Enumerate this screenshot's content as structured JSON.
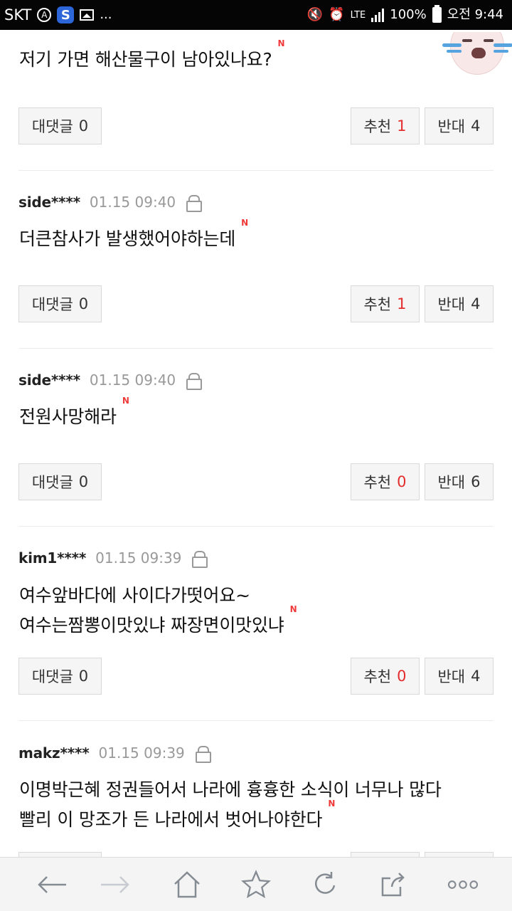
{
  "status_bar": {
    "carrier": "SKT",
    "more": "...",
    "network": "LTE",
    "battery": "100%",
    "time": "오전 9:44"
  },
  "comments": [
    {
      "author": "",
      "time": "",
      "text": "저기 가면 해산물구이 남아있나요?",
      "new": "N",
      "reply_label": "대댓글",
      "reply_count": "0",
      "recommend_label": "추천",
      "recommend_count": "1",
      "oppose_label": "반대",
      "oppose_count": "4"
    },
    {
      "author": "side****",
      "time": "01.15 09:40",
      "text": "더큰참사가 발생했어야하는데",
      "new": "N",
      "reply_label": "대댓글",
      "reply_count": "0",
      "recommend_label": "추천",
      "recommend_count": "1",
      "oppose_label": "반대",
      "oppose_count": "4"
    },
    {
      "author": "side****",
      "time": "01.15 09:40",
      "text": "전원사망해라",
      "new": "N",
      "reply_label": "대댓글",
      "reply_count": "0",
      "recommend_label": "추천",
      "recommend_count": "0",
      "oppose_label": "반대",
      "oppose_count": "6"
    },
    {
      "author": "kim1****",
      "time": "01.15 09:39",
      "text_line1": "여수앞바다에 사이다가떳어요~",
      "text_line2": "여수는짬뽕이맛있냐 짜장면이맛있냐",
      "new": "N",
      "reply_label": "대댓글",
      "reply_count": "0",
      "recommend_label": "추천",
      "recommend_count": "0",
      "oppose_label": "반대",
      "oppose_count": "4"
    },
    {
      "author": "makz****",
      "time": "01.15 09:39",
      "text_line1": "이명박근혜 정권들어서 나라에 흉흉한 소식이 너무나 많다",
      "text_line2": "빨리 이 망조가 든 나라에서 벗어나야한다",
      "new": "N"
    }
  ],
  "bottom_nav": {
    "items": [
      "back-icon",
      "forward-icon",
      "home-icon",
      "bookmark-star-icon",
      "refresh-icon",
      "share-icon",
      "more-icon"
    ]
  },
  "colors": {
    "accent_red": "#e42e2e",
    "new_badge": "#f03a3a",
    "status_bar": "#050505"
  }
}
